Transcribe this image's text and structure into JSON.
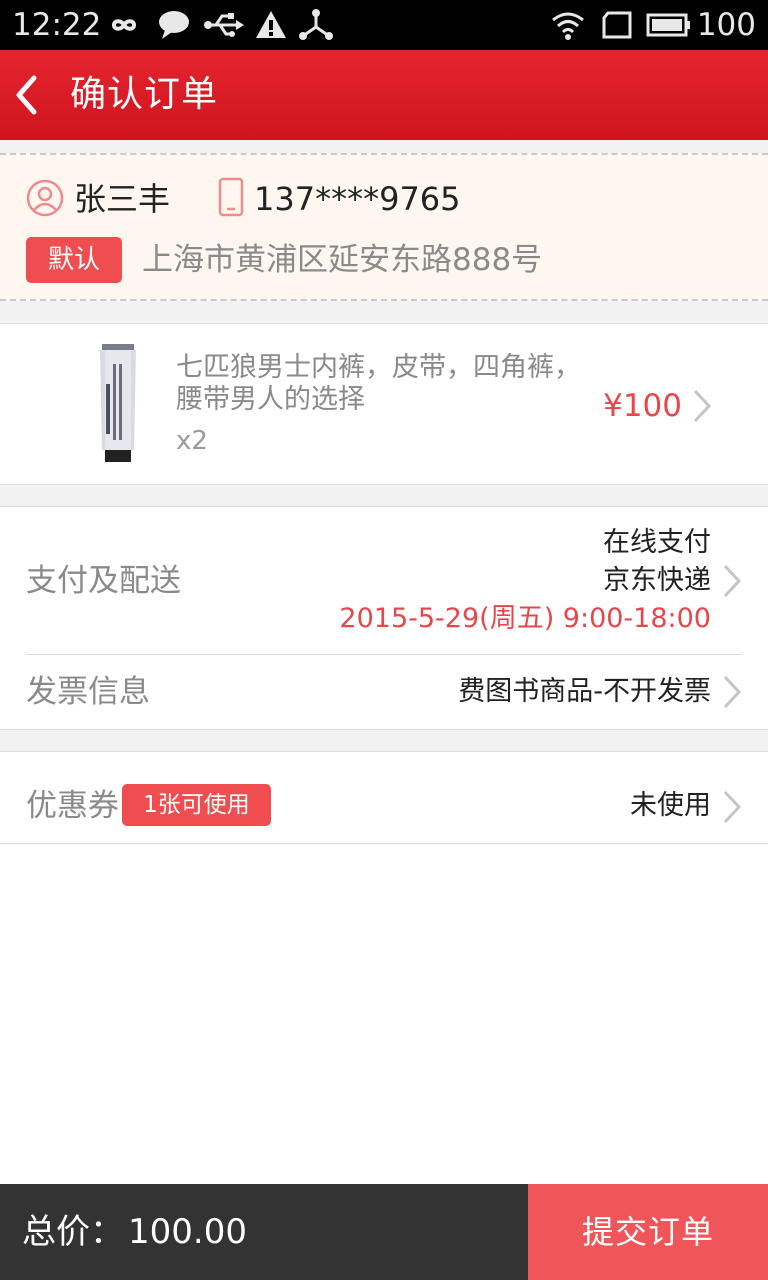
{
  "status_bar": {
    "time": "12:22",
    "battery": "100",
    "icons": [
      "infinity-icon",
      "chat-bubble-icon",
      "usb-icon",
      "warning-icon",
      "share-icon",
      "wifi-icon",
      "sim-icon",
      "battery-icon"
    ]
  },
  "header": {
    "title": "确认订单",
    "back_icon": "back-arrow-icon"
  },
  "address": {
    "name": "张三丰",
    "phone": "137****9765",
    "default_badge": "默认",
    "detail": "上海市黄浦区延安东路888号"
  },
  "product": {
    "name": "七匹狼男士内裤，皮带，四角裤，腰带男人的选择",
    "quantity": "x2",
    "price": "¥100"
  },
  "payment": {
    "label": "支付及配送",
    "method": "在线支付",
    "courier": "京东快递",
    "delivery_time": "2015-5-29(周五) 9:00-18:00"
  },
  "invoice": {
    "label": "发票信息",
    "value": "费图书商品-不开发票"
  },
  "coupon": {
    "label": "优惠券",
    "badge": "1张可使用",
    "value": "未使用"
  },
  "footer": {
    "total_label": "总价：",
    "total_value": "100.00",
    "submit_label": "提交订单"
  },
  "colors": {
    "accent": "#e3252f",
    "badge": "#ef4d4f",
    "price": "#e8464b",
    "footer_dark": "#333333",
    "submit": "#f0555a"
  }
}
